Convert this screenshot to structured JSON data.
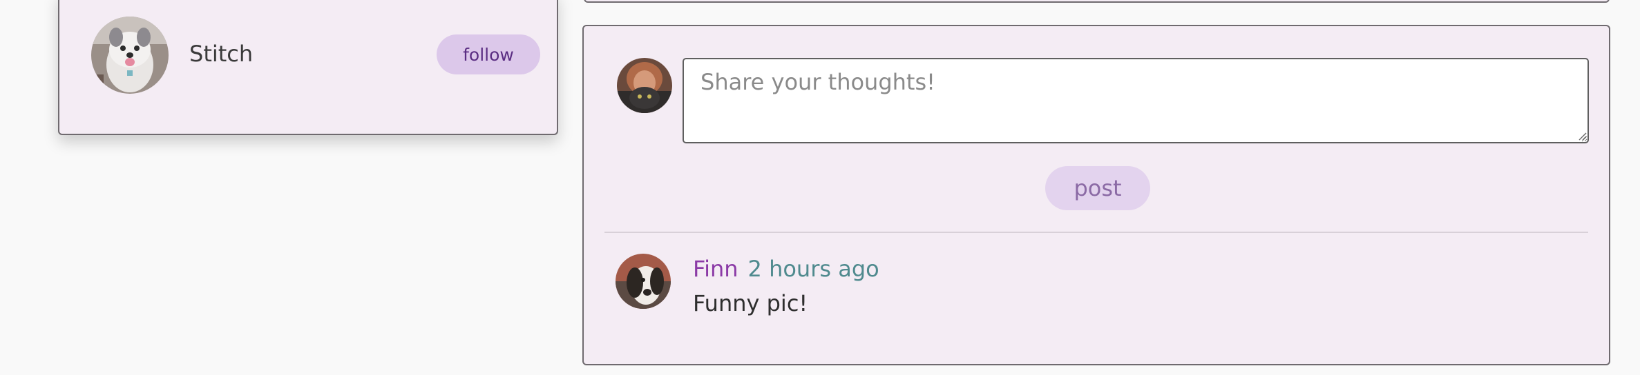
{
  "follow_suggestions": {
    "items": [
      {
        "name": "Stitch",
        "follow_label": "follow",
        "avatar_icon": "dog-photo-icon"
      }
    ]
  },
  "composer": {
    "placeholder": "Share your thoughts!",
    "value": "",
    "post_label": "post",
    "avatar_icon": "user-photo-icon"
  },
  "comments": [
    {
      "author": "Finn",
      "time": "2 hours ago",
      "text": "Funny pic!",
      "avatar_icon": "dog-photo-icon"
    }
  ],
  "colors": {
    "card_background": "#f4ecf4",
    "page_background": "#f9f9f9",
    "follow_button_background": "#dcc8ea",
    "follow_button_text": "#5a2d82",
    "post_button_background": "#e3d3ee",
    "post_button_text": "#8b6aa5",
    "author_link": "#8b3aa6",
    "timestamp": "#4f8a8e",
    "border": "#6f6a6f"
  }
}
